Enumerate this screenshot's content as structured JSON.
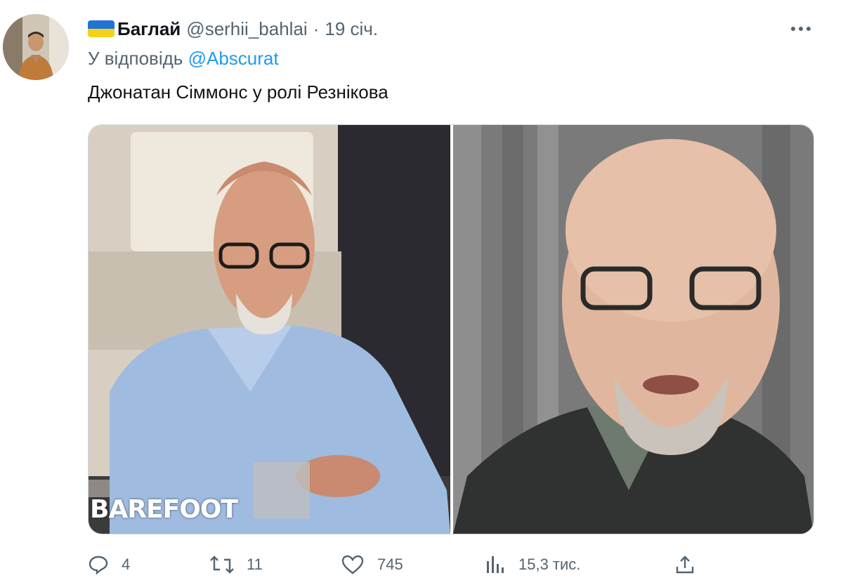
{
  "author": {
    "display_name": "Баглай",
    "handle": "@serhii_bahlai",
    "separator": "·",
    "date": "19 січ.",
    "flag_icon": "ukraine-flag-icon",
    "flag_colors": [
      "#1f74d6",
      "#f7d117"
    ]
  },
  "reply": {
    "prefix": "У відповідь ",
    "mention": "@Abscurat"
  },
  "text": "Джонатан Сіммонс у ролі Резнікова",
  "media": {
    "left_watermark": "BAREFOOT"
  },
  "actions": {
    "replies": "4",
    "retweets": "11",
    "likes": "745",
    "views": "15,3 тис."
  },
  "colors": {
    "text": "#0f1419",
    "secondary": "#536471",
    "link": "#1d9bf0"
  }
}
